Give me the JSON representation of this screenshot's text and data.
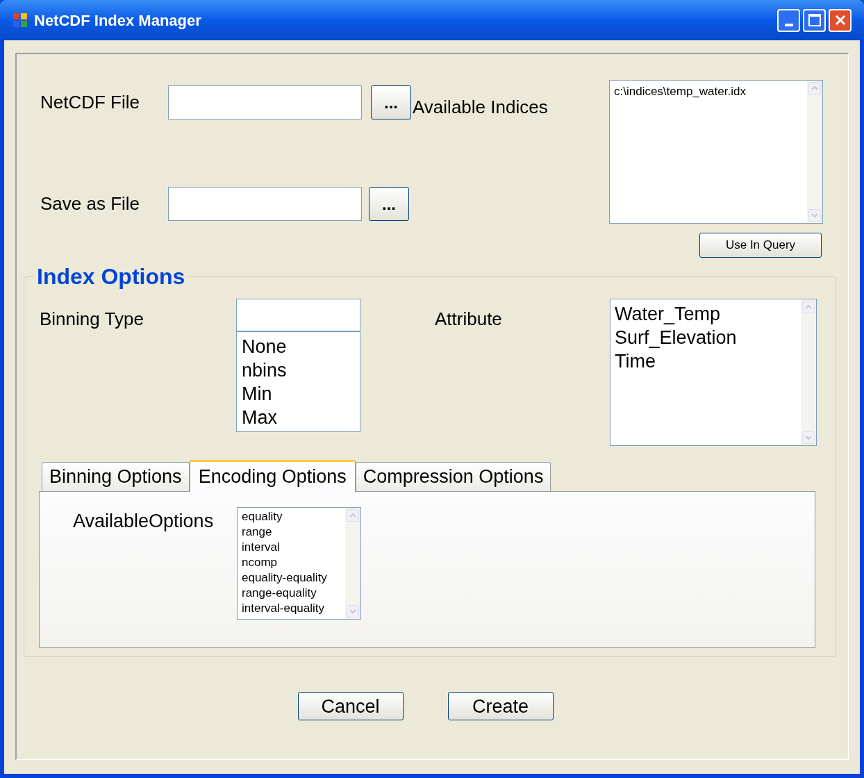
{
  "window": {
    "title": "NetCDF Index Manager"
  },
  "netcdf_file": {
    "label": "NetCDF File",
    "browse_button": "..."
  },
  "save_as_file": {
    "label": "Save as File",
    "browse_button": "..."
  },
  "available_indices": {
    "label": "Available Indices",
    "items": [
      "c:\\indices\\temp_water.idx"
    ],
    "button": "Use In Query"
  },
  "index_options": {
    "title": "Index Options",
    "binning_type": {
      "label": "Binning Type",
      "options": [
        "None",
        "nbins",
        "Min",
        "Max"
      ]
    },
    "attribute": {
      "label": "Attribute",
      "items": [
        "Water_Temp",
        "Surf_Elevation",
        "Time"
      ]
    },
    "tabs": [
      {
        "label": "Binning Options",
        "selected": false
      },
      {
        "label": "Encoding Options",
        "selected": true
      },
      {
        "label": "Compression Options",
        "selected": false
      }
    ],
    "available_options": {
      "label": "AvailableOptions",
      "items": [
        "equality",
        "range",
        "interval",
        "ncomp",
        "equality-equality",
        "range-equality",
        "interval-equality"
      ]
    }
  },
  "buttons": [
    "Cancel",
    "Create"
  ]
}
